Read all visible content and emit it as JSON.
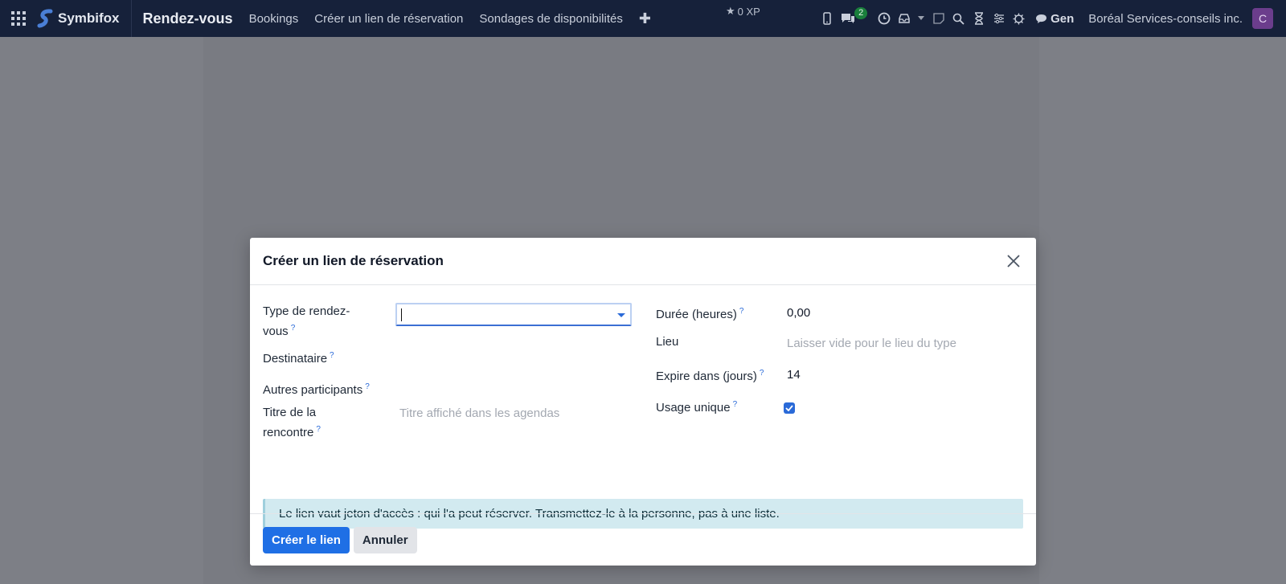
{
  "navbar": {
    "brand": "Symbifox",
    "app_title": "Rendez-vous",
    "menu": [
      "Bookings",
      "Créer un lien de réservation",
      "Sondages de disponibilités"
    ],
    "xp": "0 XP",
    "messages_count": "2",
    "gen_label": "Gen",
    "company": "Boréal Services-conseils inc.",
    "avatar_initial": "C"
  },
  "modal": {
    "title": "Créer un lien de réservation",
    "fields_left": {
      "type_label": "Type de rendez-vous",
      "type_label_l1": "Type de rendez-",
      "type_label_l2": "vous",
      "type_value": "",
      "recipient_label": "Destinataire",
      "others_label": "Autres participants",
      "title_label_l1": "Titre de la",
      "title_label_l2": "rencontre",
      "title_placeholder": "Titre affiché dans les agendas"
    },
    "fields_right": {
      "duration_label": "Durée (heures)",
      "duration_value": "0,00",
      "location_label": "Lieu",
      "location_placeholder": "Laisser vide pour le lieu du type",
      "expires_label": "Expire dans (jours)",
      "expires_value": "14",
      "single_use_label": "Usage unique",
      "single_use_checked": true
    },
    "help_mark": "?",
    "alert": "Le lien vaut jeton d'accès : qui l'a peut réserver. Transmettez-le à la personne, pas à une liste.",
    "buttons": {
      "create": "Créer le lien",
      "cancel": "Annuler"
    }
  },
  "colors": {
    "navbar_bg": "#16213a",
    "primary": "#1f6fe5",
    "alert_bg": "#d2eaf0"
  }
}
